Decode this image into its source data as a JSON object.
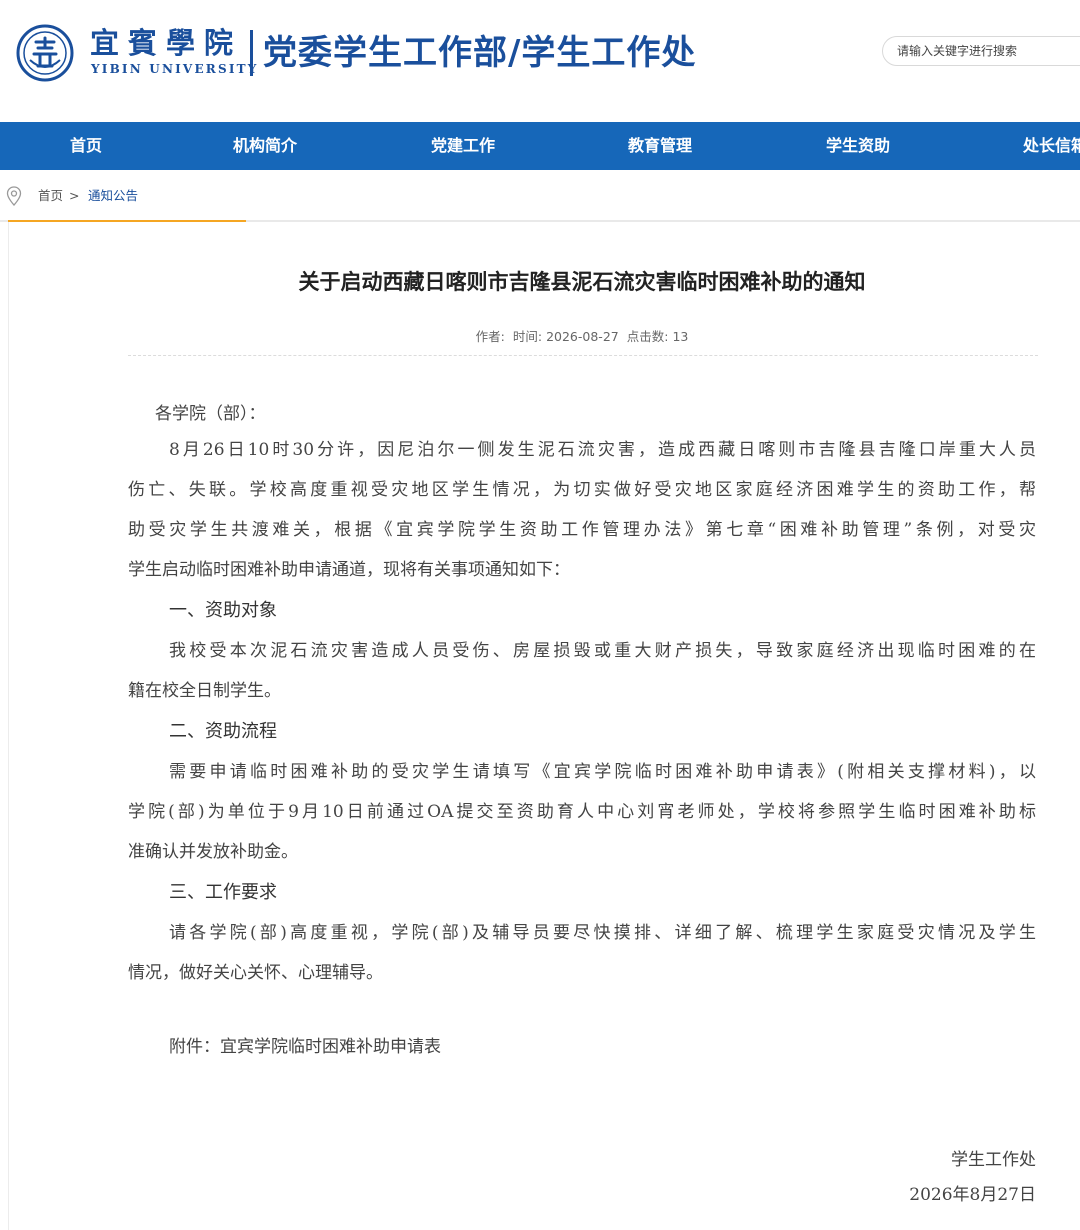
{
  "header": {
    "logo_cn": "宜賓學院",
    "logo_en": "YIBIN UNIVERSITY",
    "site_title": "党委学生工作部/学生工作处",
    "search_placeholder": "请输入关键字进行搜索"
  },
  "nav": {
    "items": [
      "首页",
      "机构简介",
      "党建工作",
      "教育管理",
      "学生资助",
      "处长信箱"
    ]
  },
  "breadcrumb": {
    "home": "首页",
    "separator": ">",
    "current": "通知公告"
  },
  "article": {
    "title": "关于启动西藏日喀则市吉隆县泥石流灾害临时困难补助的通知",
    "meta": {
      "author_label": "作者:",
      "time_label": "时间:",
      "date": "2026-08-27",
      "clicks_label": "点击数:",
      "clicks": "13"
    },
    "salutation": "各学院（部）：",
    "intro_lines": [
      "8月26日10时30分许，因尼泊尔一侧发生泥石流灾害，造成西藏日喀则市吉隆县吉隆口岸重大人员",
      "伤亡、失联。学校高度重视受灾地区学生情况，为切实做好受灾地区家庭经济困难学生的资助工作，帮",
      "助受灾学生共渡难关，根据《宜宾学院学生资助工作管理办法》第七章“困难补助管理”条例，对受灾",
      "学生启动临时困难补助申请通道，现将有关事项通知如下："
    ],
    "section1_heading": "一、资助对象",
    "section1_lines": [
      "我校受本次泥石流灾害造成人员受伤、房屋损毁或重大财产损失，导致家庭经济出现临时困难的在",
      "籍在校全日制学生。"
    ],
    "section2_heading": "二、资助流程",
    "section2_lines": [
      "需要申请临时困难补助的受灾学生请填写《宜宾学院临时困难补助申请表》(附相关支撑材料)，以",
      "学院(部)为单位于9月10日前通过OA提交至资助育人中心刘宵老师处，学校将参照学生临时困难补助标",
      "准确认并发放补助金。"
    ],
    "section3_heading": "三、工作要求",
    "section3_lines": [
      "请各学院(部)高度重视，学院(部)及辅导员要尽快摸排、详细了解、梳理学生家庭受灾情况及学生",
      "情况，做好关心关怀、心理辅导。"
    ],
    "attachment": "附件：宜宾学院临时困难补助申请表",
    "signature_org": "学生工作处",
    "signature_date": "2026年8月27日"
  },
  "colors": {
    "brand_blue": "#1a4f9c",
    "nav_blue": "#1667b9",
    "accent_orange": "#f5a623"
  }
}
